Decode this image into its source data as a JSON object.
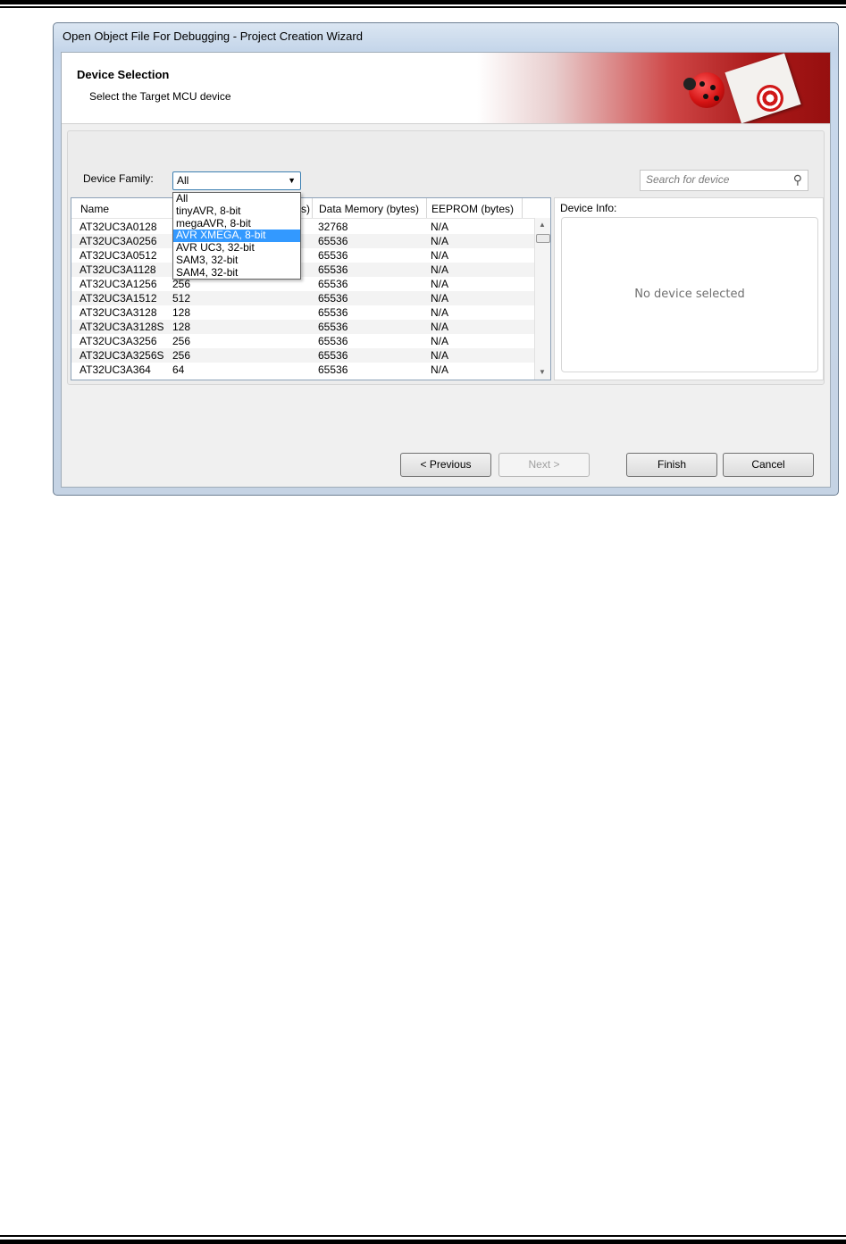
{
  "window": {
    "title": "Open Object File For Debugging  -  Project Creation Wizard"
  },
  "banner": {
    "title": "Device Selection",
    "subtitle": "Select the Target MCU device"
  },
  "device_family": {
    "label": "Device Family:",
    "selected": "All",
    "options": [
      "All",
      "tinyAVR, 8-bit",
      "megaAVR, 8-bit",
      "AVR XMEGA, 8-bit",
      "AVR UC3, 32-bit",
      "SAM3, 32-bit",
      "SAM4, 32-bit"
    ],
    "highlighted": "AVR XMEGA, 8-bit"
  },
  "search": {
    "placeholder": "Search for device"
  },
  "table": {
    "columns": [
      "Name",
      "s)",
      "Data Memory (bytes)",
      "EEPROM (bytes)"
    ],
    "rows": [
      [
        "AT32UC3A0128",
        "",
        "32768",
        "N/A"
      ],
      [
        "AT32UC3A0256",
        "",
        "65536",
        "N/A"
      ],
      [
        "AT32UC3A0512",
        "",
        "65536",
        "N/A"
      ],
      [
        "AT32UC3A1128",
        "",
        "65536",
        "N/A"
      ],
      [
        "AT32UC3A1256",
        "256",
        "65536",
        "N/A"
      ],
      [
        "AT32UC3A1512",
        "512",
        "65536",
        "N/A"
      ],
      [
        "AT32UC3A3128",
        "128",
        "65536",
        "N/A"
      ],
      [
        "AT32UC3A3128S",
        "128",
        "65536",
        "N/A"
      ],
      [
        "AT32UC3A3256",
        "256",
        "65536",
        "N/A"
      ],
      [
        "AT32UC3A3256S",
        "256",
        "65536",
        "N/A"
      ],
      [
        "AT32UC3A364",
        "64",
        "65536",
        "N/A"
      ]
    ]
  },
  "device_info": {
    "label": "Device Info:",
    "empty_text": "No device selected"
  },
  "buttons": {
    "previous": "< Previous",
    "next": "Next >",
    "finish": "Finish",
    "cancel": "Cancel"
  },
  "colors": {
    "selection": "#3399ff",
    "window_frame": "#c5d6ea",
    "banner_red": "#c41c1c"
  }
}
